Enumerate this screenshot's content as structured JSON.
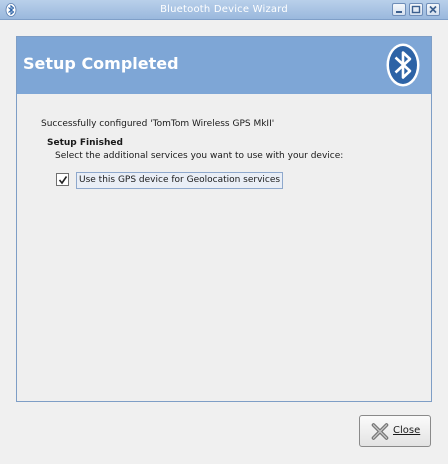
{
  "window": {
    "title": "Bluetooth Device Wizard",
    "icon": "bluetooth-icon",
    "controls": [
      "minimize-icon",
      "maximize-icon",
      "close-icon"
    ]
  },
  "header": {
    "title": "Setup Completed",
    "logo": "bluetooth-logo-icon"
  },
  "content": {
    "success_message": "Successfully configured 'TomTom Wireless GPS MkII'",
    "section_title": "Setup Finished",
    "instruction": "Select the additional services you want to use with your device:",
    "options": [
      {
        "label": "Use this GPS device for Geolocation services",
        "checked": true
      }
    ]
  },
  "footer": {
    "close_label": "Close",
    "close_icon": "close-x-icon"
  },
  "colors": {
    "header_bg": "#7ea6d6",
    "titlebar_bg": "#a9c4e4",
    "logo_bg": "#2d63a6"
  }
}
